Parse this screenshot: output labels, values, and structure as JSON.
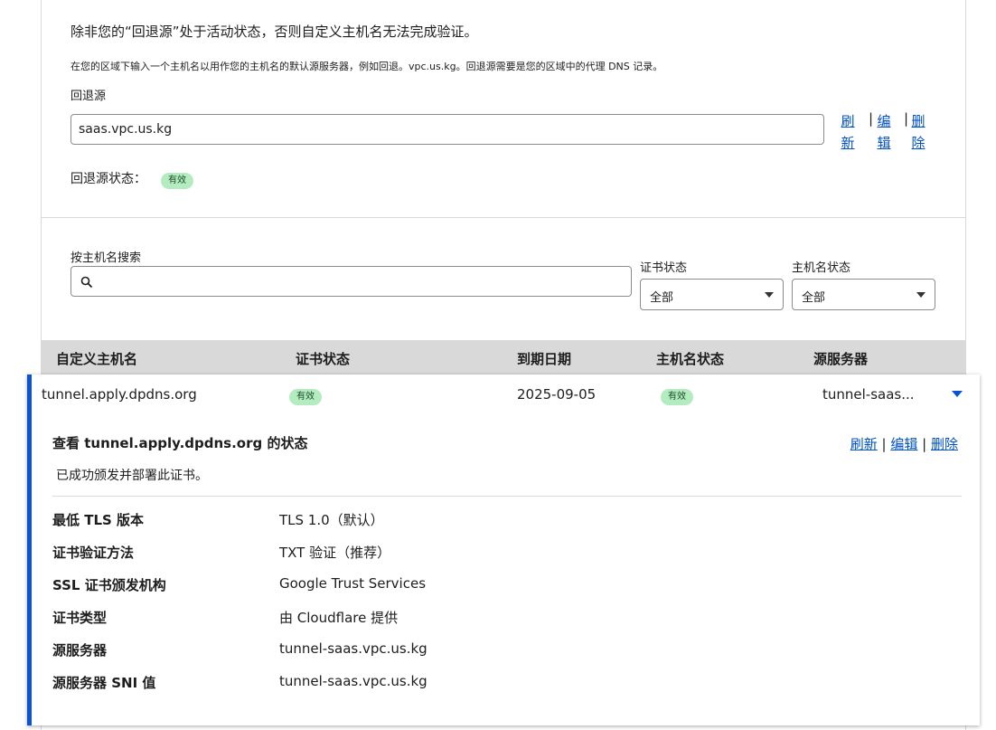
{
  "fallback": {
    "warning": "除非您的“回退源”处于活动状态，否则自定义主机名无法完成验证。",
    "description": "在您的区域下输入一个主机名以用作您的主机名的默认源服务器，例如回退。vpc.us.kg。回退源需要是您的区域中的代理 DNS 记录。",
    "label": "回退源",
    "value": "saas.vpc.us.kg",
    "actions": {
      "refresh": [
        "刷",
        "新"
      ],
      "edit": [
        "编",
        "辑"
      ],
      "delete": [
        "删",
        "除"
      ],
      "separator": "|"
    },
    "status_label": "回退源状态：",
    "status_badge": "有效"
  },
  "filters": {
    "search_label": "按主机名搜索",
    "search_placeholder": "",
    "cert_status_label": "证书状态",
    "cert_status_value": "全部",
    "hostname_status_label": "主机名状态",
    "hostname_status_value": "全部"
  },
  "table": {
    "headers": [
      "自定义主机名",
      "证书状态",
      "到期日期",
      "主机名状态",
      "源服务器"
    ],
    "row": {
      "hostname": "tunnel.apply.dpdns.org",
      "cert_status": "有效",
      "expiry": "2025-09-05",
      "hostname_status": "有效",
      "origin": "tunnel-saas..."
    }
  },
  "detail": {
    "title": "查看 tunnel.apply.dpdns.org 的状态",
    "actions": {
      "refresh": "刷新",
      "edit": "编辑",
      "delete": "删除",
      "separator": " | "
    },
    "message": "已成功颁发并部署此证书。",
    "items": [
      {
        "key": "最低 TLS 版本",
        "value": "TLS 1.0（默认）"
      },
      {
        "key": "证书验证方法",
        "value": "TXT 验证（推荐）"
      },
      {
        "key": "SSL 证书颁发机构",
        "value": "Google Trust Services"
      },
      {
        "key": "证书类型",
        "value": "由 Cloudflare 提供"
      },
      {
        "key": "源服务器",
        "value": "tunnel-saas.vpc.us.kg"
      },
      {
        "key": "源服务器 SNI 值",
        "value": "tunnel-saas.vpc.us.kg"
      }
    ]
  },
  "colors": {
    "link": "#0051c3",
    "accent": "#0a52d6",
    "badge_bg": "#b4ecc0"
  }
}
